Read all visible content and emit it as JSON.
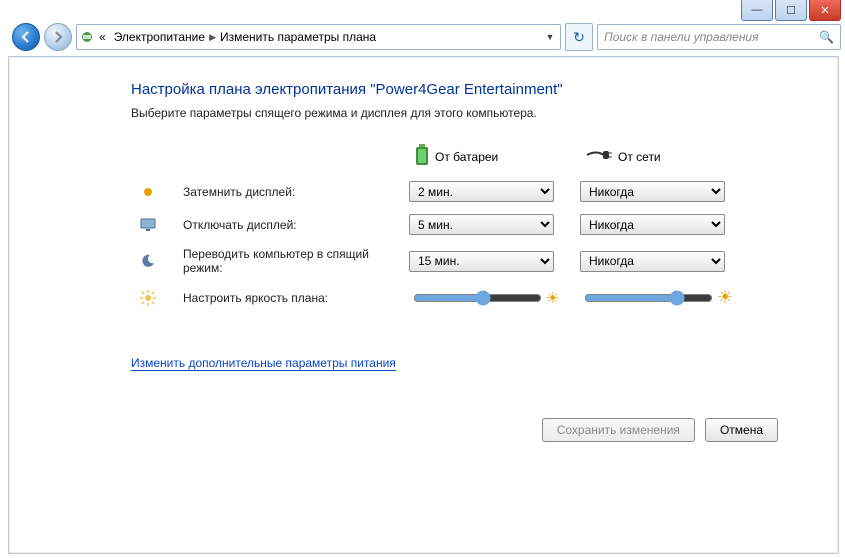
{
  "window": {
    "min": "—",
    "max": "☐",
    "close": "✕"
  },
  "nav": {
    "crumb_prefix": "«",
    "crumb1": "Электропитание",
    "crumb2": "Изменить параметры плана",
    "refresh_glyph": "↻"
  },
  "search": {
    "placeholder": "Поиск в панели управления"
  },
  "page": {
    "title": "Настройка плана электропитания \"Power4Gear Entertainment\"",
    "subtitle": "Выберите параметры спящего режима и дисплея для этого компьютера."
  },
  "cols": {
    "battery": "От батареи",
    "ac": "От сети"
  },
  "rows": {
    "dim": "Затемнить дисплей:",
    "off": "Отключать дисплей:",
    "sleep": "Переводить компьютер в спящий режим:",
    "bright": "Настроить яркость плана:"
  },
  "values": {
    "dim_battery": "2 мин.",
    "dim_ac": "Никогда",
    "off_battery": "5 мин.",
    "off_ac": "Никогда",
    "sleep_battery": "15 мин.",
    "sleep_ac": "Никогда",
    "bright_battery": 55,
    "bright_ac": 75
  },
  "link_advanced": "Изменить дополнительные параметры питания",
  "buttons": {
    "save": "Сохранить изменения",
    "cancel": "Отмена"
  }
}
